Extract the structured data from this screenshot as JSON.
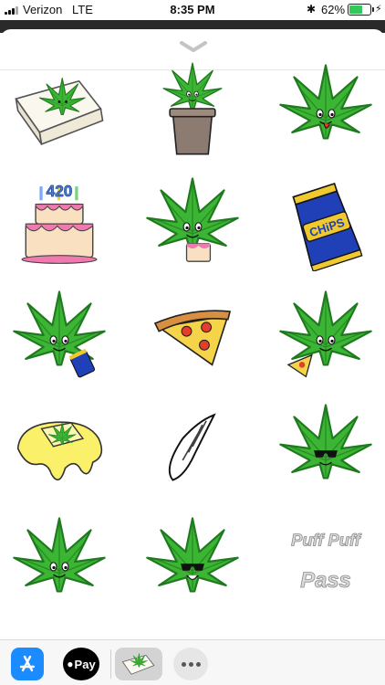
{
  "status_bar": {
    "carrier": "Verizon",
    "network": "LTE",
    "time": "8:35 PM",
    "battery": "62%",
    "battery_level": 0.62,
    "colors": {
      "battery_fill": "#34c759"
    }
  },
  "stickers": [
    {
      "name": "leaf-in-rolling-paper",
      "text": ""
    },
    {
      "name": "leaf-in-flower-pot",
      "text": ""
    },
    {
      "name": "leaf-tongue-out",
      "text": ""
    },
    {
      "name": "420-birthday-cake",
      "text": "420"
    },
    {
      "name": "leaf-eating-cake",
      "text": ""
    },
    {
      "name": "bag-of-chips",
      "text": "CHiPS"
    },
    {
      "name": "leaf-eating-chips",
      "text": ""
    },
    {
      "name": "pizza-slice",
      "text": ""
    },
    {
      "name": "leaf-eating-pizza",
      "text": ""
    },
    {
      "name": "melted-butter-leaf",
      "text": ""
    },
    {
      "name": "rolled-joint",
      "text": ""
    },
    {
      "name": "leaf-with-sunglasses",
      "text": ""
    },
    {
      "name": "leaf-smiling",
      "text": ""
    },
    {
      "name": "leaf-sunglasses-smiling",
      "text": ""
    },
    {
      "name": "puff-puff-pass-smoke-text",
      "text": "Puff Puff Pass"
    }
  ],
  "tray": {
    "applepay_label": "Pay",
    "items": [
      "app-store-icon",
      "apple-pay-icon",
      "weed-sticker-app-icon",
      "more-icon"
    ]
  },
  "colors": {
    "leaf": "#3cb534",
    "leaf_dark": "#1f7a1f",
    "accent": "#1a8cff"
  }
}
